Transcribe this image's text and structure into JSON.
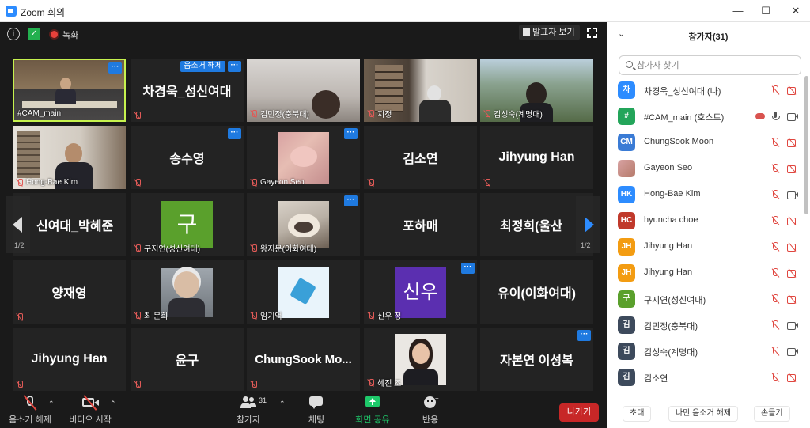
{
  "window": {
    "title": "Zoom 회의"
  },
  "meeting": {
    "recording_label": "녹화",
    "view_label": "발표자 보기",
    "page_indicator": "1/2"
  },
  "tiles": [
    {
      "caption": "#CAM_main"
    },
    {
      "big": "차경욱_성신여대",
      "tag": "음소거 해제"
    },
    {
      "caption": "김민정(충북대)"
    },
    {
      "caption": "지정"
    },
    {
      "caption": "김성숙(계명대)"
    },
    {
      "caption": "Hong-Bae Kim"
    },
    {
      "big": "송수영"
    },
    {
      "caption": "Gayeon Seo"
    },
    {
      "big": "김소연"
    },
    {
      "big": "Jihyung Han"
    },
    {
      "big": "신여대_박혜준"
    },
    {
      "caption": "구지연(성신여대)",
      "avatar": "구"
    },
    {
      "caption": "왕지문(이화여대)"
    },
    {
      "big": "포하매"
    },
    {
      "big": "최정희(울산"
    },
    {
      "big": "양재영"
    },
    {
      "caption": "최 문희"
    },
    {
      "caption": "임기억"
    },
    {
      "caption": "신우 정",
      "avatar": "신우"
    },
    {
      "big": "유이(이화여대)"
    },
    {
      "big": "Jihyung Han"
    },
    {
      "big": "윤구"
    },
    {
      "big": "ChungSook Mo..."
    },
    {
      "caption": "혜진 조"
    },
    {
      "big": "자본연 이성복"
    }
  ],
  "toolbar": {
    "unmute": "음소거 해제",
    "start_video": "비디오 시작",
    "participants": "참가자",
    "participants_count": "31",
    "chat": "채팅",
    "share": "화면 공유",
    "reactions": "반응",
    "leave": "나가기"
  },
  "panel": {
    "title": "참가자(31)",
    "search_placeholder": "참가자 찾기",
    "participants": [
      {
        "initials": "차",
        "name": "차경욱_성신여대 (나)",
        "color": "#2d8cff"
      },
      {
        "initials": "#",
        "name": "#CAM_main (호스트)",
        "color": "#23a55a"
      },
      {
        "initials": "CM",
        "name": "ChungSook Moon",
        "color": "#3a7bd5"
      },
      {
        "initials": "",
        "name": "Gayeon Seo",
        "color": "#c98b6b"
      },
      {
        "initials": "HK",
        "name": "Hong-Bae Kim",
        "color": "#2d8cff"
      },
      {
        "initials": "HC",
        "name": "hyuncha choe",
        "color": "#c0392b"
      },
      {
        "initials": "JH",
        "name": "Jihyung Han",
        "color": "#f39c12"
      },
      {
        "initials": "JH",
        "name": "Jihyung Han",
        "color": "#f39c12"
      },
      {
        "initials": "구",
        "name": "구지연(성신여대)",
        "color": "#5aa02c"
      },
      {
        "initials": "김",
        "name": "김민정(충북대)",
        "color": "#3d4a5c"
      },
      {
        "initials": "김",
        "name": "김성숙(계명대)",
        "color": "#3d4a5c"
      },
      {
        "initials": "김",
        "name": "김소연",
        "color": "#3d4a5c"
      }
    ],
    "footer": {
      "invite": "초대",
      "mute_me": "나만 음소거 해제",
      "raise_hand": "손들기"
    }
  },
  "colors": {
    "accent": "#2d8cff",
    "leave": "#c72727",
    "share": "#1ec96a",
    "mute": "#e0463f"
  }
}
